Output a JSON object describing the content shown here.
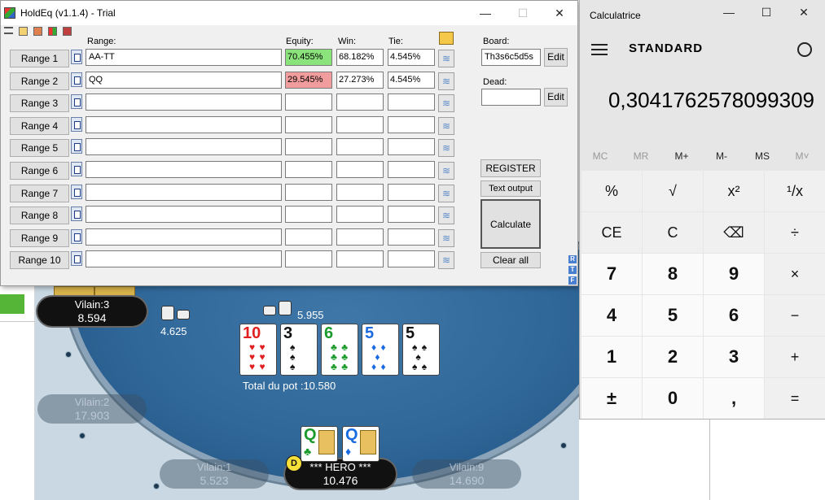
{
  "holdeq": {
    "title": "HoldEq (v1.1.4) - Trial",
    "window_buttons": {
      "minimize": "—",
      "maximize": "☐",
      "close": "✕"
    },
    "headers": {
      "range": "Range:",
      "equity": "Equity:",
      "win": "Win:",
      "tie": "Tie:"
    },
    "rows": [
      {
        "label": "Range 1",
        "range": "AA-TT",
        "equity": "70.455%",
        "win": "68.182%",
        "tie": "4.545%"
      },
      {
        "label": "Range 2",
        "range": "QQ",
        "equity": "29.545%",
        "win": "27.273%",
        "tie": "4.545%"
      },
      {
        "label": "Range 3",
        "range": "",
        "equity": "",
        "win": "",
        "tie": ""
      },
      {
        "label": "Range 4",
        "range": "",
        "equity": "",
        "win": "",
        "tie": ""
      },
      {
        "label": "Range 5",
        "range": "",
        "equity": "",
        "win": "",
        "tie": ""
      },
      {
        "label": "Range 6",
        "range": "",
        "equity": "",
        "win": "",
        "tie": ""
      },
      {
        "label": "Range 7",
        "range": "",
        "equity": "",
        "win": "",
        "tie": ""
      },
      {
        "label": "Range 8",
        "range": "",
        "equity": "",
        "win": "",
        "tie": ""
      },
      {
        "label": "Range 9",
        "range": "",
        "equity": "",
        "win": "",
        "tie": ""
      },
      {
        "label": "Range 10",
        "range": "",
        "equity": "",
        "win": "",
        "tie": ""
      }
    ],
    "colors": {
      "equity_win": "#8be37b",
      "equity_lose": "#f29d9d"
    },
    "board_label": "Board:",
    "board_value": "Th3s6c5d5s",
    "dead_label": "Dead:",
    "dead_value": "",
    "edit_label": "Edit",
    "register_label": "REGISTER",
    "text_output_label": "Text output",
    "calculate_label": "Calculate",
    "clear_all_label": "Clear all",
    "side_letters": [
      "R",
      "T",
      "F"
    ]
  },
  "calculator": {
    "title": "Calculatrice",
    "mode": "STANDARD",
    "display": "0,3041762578099309",
    "memory": [
      "MC",
      "MR",
      "M+",
      "M-",
      "MS",
      "M˅"
    ],
    "keys": [
      [
        "%",
        "√",
        "x²",
        "¹/x"
      ],
      [
        "CE",
        "C",
        "⌫",
        "÷"
      ],
      [
        "7",
        "8",
        "9",
        "×"
      ],
      [
        "4",
        "5",
        "6",
        "−"
      ],
      [
        "1",
        "2",
        "3",
        "+"
      ],
      [
        "±",
        "0",
        ",",
        "="
      ]
    ]
  },
  "table": {
    "seats": [
      {
        "name": "Vilain:3",
        "stack": "8.594",
        "active": true
      },
      {
        "name": "Vilain:2",
        "stack": "17.903",
        "active": false
      },
      {
        "name": "Vilain:1",
        "stack": "5.523",
        "active": false
      },
      {
        "name": "*** HERO ***",
        "stack": "10.476",
        "active": true
      },
      {
        "name": "Vilain:9",
        "stack": "14.690",
        "active": false
      }
    ],
    "bet_left": "4.625",
    "bet_center": "5.955",
    "pot_text": "Total du pot :10.580",
    "dealer": "D",
    "board_cards": [
      {
        "rank": "10",
        "suit": "♥",
        "color": "red"
      },
      {
        "rank": "3",
        "suit": "♠",
        "color": "black"
      },
      {
        "rank": "6",
        "suit": "♣",
        "color": "green"
      },
      {
        "rank": "5",
        "suit": "♦",
        "color": "blue"
      },
      {
        "rank": "5",
        "suit": "♠",
        "color": "black"
      }
    ],
    "hero_cards": [
      {
        "rank": "Q",
        "suit": "♣",
        "color": "green"
      },
      {
        "rank": "Q",
        "suit": "♦",
        "color": "blue"
      }
    ]
  }
}
